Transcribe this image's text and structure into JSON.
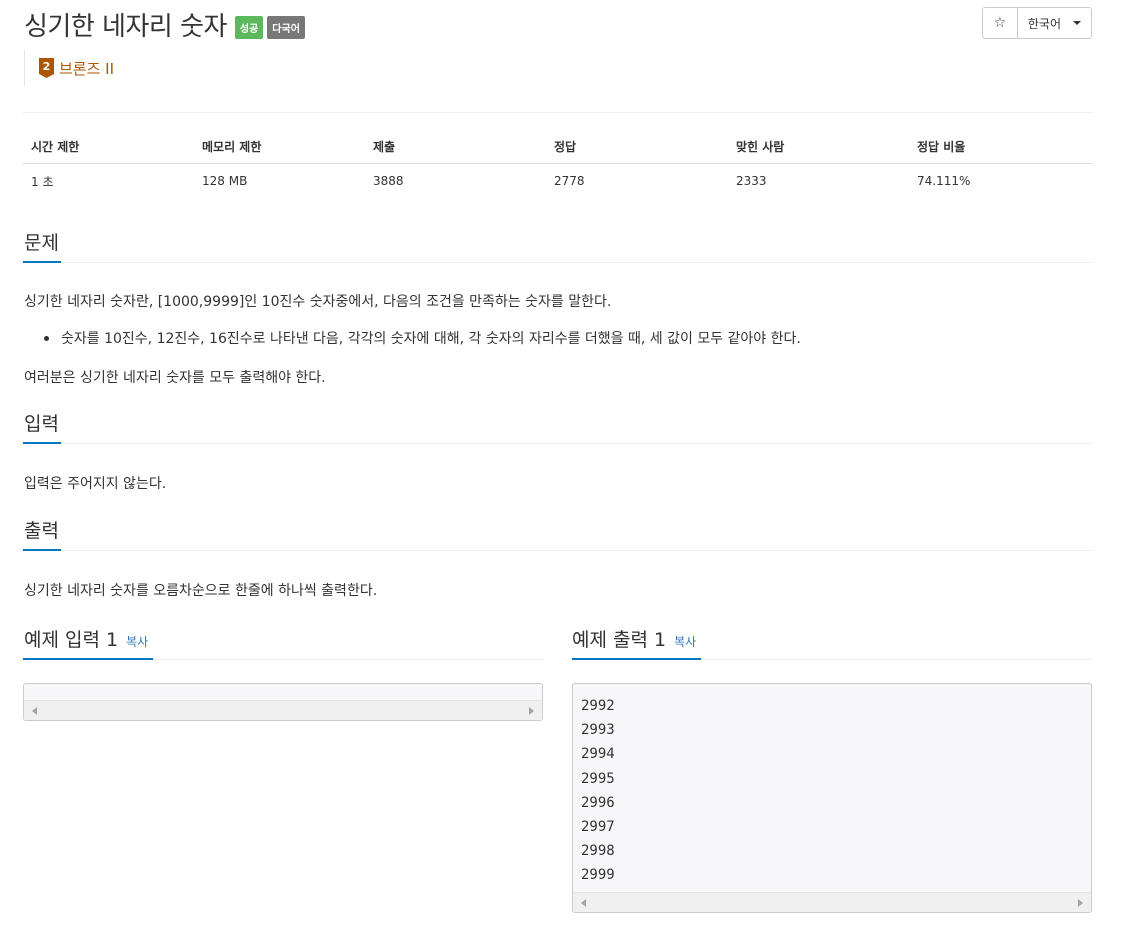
{
  "problem": {
    "title": "싱기한 네자리 숫자",
    "badges": {
      "success": "성공",
      "multilang": "다국어"
    },
    "tier": {
      "level": "2",
      "name": "브론즈 II",
      "color": "#ad5600"
    }
  },
  "toolbar": {
    "star": "☆",
    "language": "한국어"
  },
  "stats": {
    "headers": [
      "시간 제한",
      "메모리 제한",
      "제출",
      "정답",
      "맞힌 사람",
      "정답 비율"
    ],
    "values": [
      "1 초",
      "128 MB",
      "3888",
      "2778",
      "2333",
      "74.111%"
    ]
  },
  "sections": {
    "description": {
      "heading": "문제",
      "para1": "싱기한 네자리 숫자란, [1000,9999]인 10진수 숫자중에서,  다음의 조건을 만족하는 숫자를 말한다.",
      "bullet1": "숫자를 10진수, 12진수, 16진수로 나타낸 다음, 각각의 숫자에 대해, 각 숫자의 자리수를 더했을 때, 세 값이 모두 같아야 한다.",
      "para2": "여러분은 싱기한 네자리 숫자를 모두 출력해야 한다."
    },
    "input": {
      "heading": "입력",
      "text": "입력은 주어지지 않는다."
    },
    "output": {
      "heading": "출력",
      "text": "싱기한 네자리 숫자를 오름차순으로 한줄에 하나씩 출력한다."
    }
  },
  "samples": {
    "input": {
      "heading": "예제 입력 1",
      "copy": "복사",
      "lines": []
    },
    "output": {
      "heading": "예제 출력 1",
      "copy": "복사",
      "lines": [
        "2992",
        "2993",
        "2994",
        "2995",
        "2996",
        "2997",
        "2998",
        "2999"
      ]
    }
  }
}
